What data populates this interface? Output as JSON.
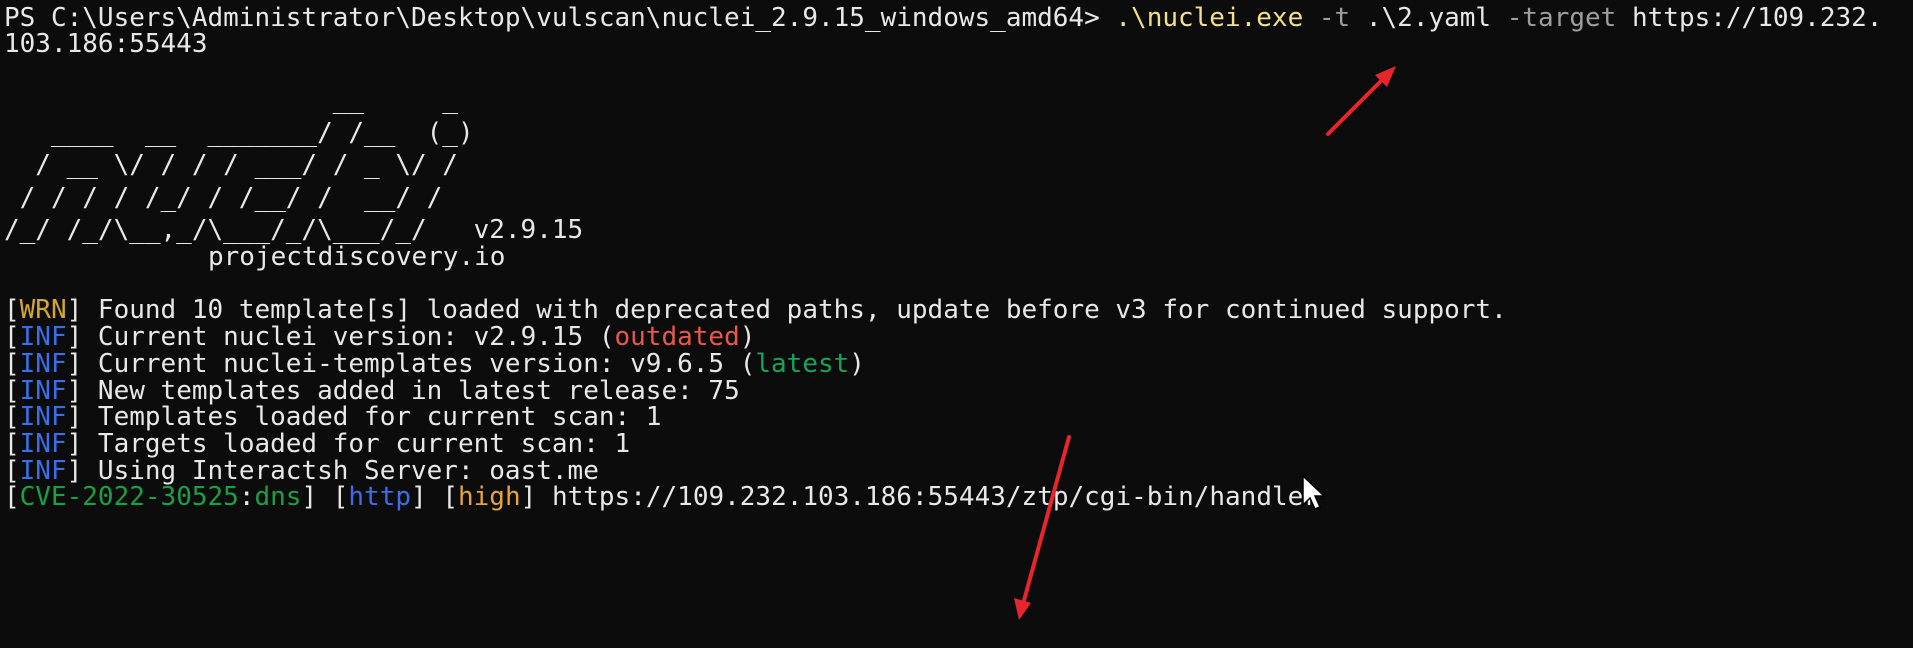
{
  "terminal": {
    "prompt": "PS C:\\Users\\Administrator\\Desktop\\vulscan\\nuclei_2.9.15_windows_amd64>",
    "cmd_exe": ".\\nuclei.exe",
    "flag_t": "-t",
    "template_arg": ".\\2.yaml",
    "flag_target": "-target",
    "target_part1": "https://109.232.",
    "target_part2": "103.186:55443",
    "banner": {
      "ascii_lines": [
        "                     __     _",
        "   ____  __  _______/ /__  (_)",
        "  / __ \\/ / / / ___/ / _ \\/ /",
        " / / / / /_/ / /__/ /  __/ /",
        "/_/ /_/\\__,_/\\___/_/\\___/_/   v2.9.15"
      ],
      "site": "projectdiscovery.io"
    },
    "logs": [
      {
        "tag": "WRN",
        "text": " Found 10 template[s] loaded with deprecated paths, update before v3 for continued support."
      },
      {
        "tag": "INF",
        "text": " Current nuclei version: v2.9.15 (",
        "highlight": "outdated",
        "tail": ")"
      },
      {
        "tag": "INF",
        "text": " Current nuclei-templates version: v9.6.5 (",
        "highlight": "latest",
        "tail": ")"
      },
      {
        "tag": "INF",
        "text": " New templates added in latest release: 75"
      },
      {
        "tag": "INF",
        "text": " Templates loaded for current scan: 1"
      },
      {
        "tag": "INF",
        "text": " Targets loaded for current scan: 1"
      },
      {
        "tag": "INF",
        "text": " Using Interactsh Server: oast.me"
      }
    ],
    "result": {
      "template_id": "CVE-2022-30525",
      "matcher": "dns",
      "protocol": "http",
      "severity": "high",
      "url": "https://109.232.103.186:55443/ztp/cgi-bin/handler"
    }
  },
  "colors": {
    "background": "#0c0c0c",
    "annotation_arrow": "#e8252b"
  }
}
